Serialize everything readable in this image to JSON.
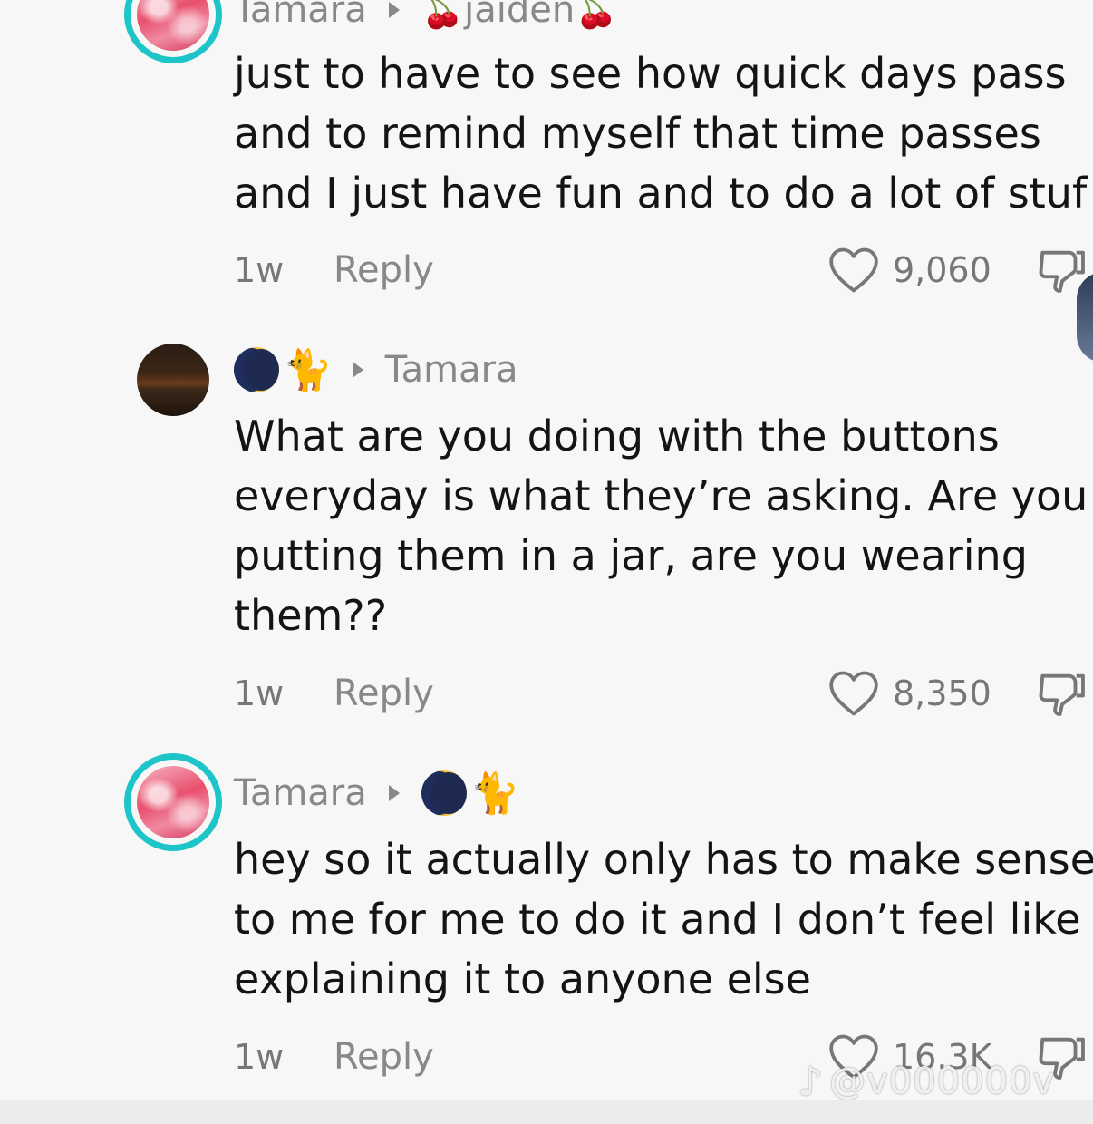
{
  "comments": [
    {
      "author": "Tamara",
      "reply_to": "jaiden",
      "reply_to_emoji": "🍒",
      "text": "just to have to see how quick days pass\nand to remind myself that time passes\nand I just have fun and to do a lot of stuf",
      "age": "1w",
      "reply_label": "Reply",
      "likes": "9,060"
    },
    {
      "author_emoji_moon": "🌗",
      "author_emoji_cat": "🐈‍⬛",
      "reply_to": "Tamara",
      "text": "What are you doing with the buttons\neveryday is what they’re asking. Are you\nputting them in a jar, are you wearing\nthem??",
      "age": "1w",
      "reply_label": "Reply",
      "likes": "8,350"
    },
    {
      "author": "Tamara",
      "reply_to_emoji_moon": "🌗",
      "reply_to_emoji_cat": "🐈‍⬛",
      "text": "hey so it actually only has to make sense\nto me for me to do it and I don’t feel like\nexplaining it to anyone else",
      "age": "1w",
      "reply_label": "Reply",
      "likes": "16.3K"
    }
  ],
  "watermark": {
    "logo": "♪",
    "handle": "@v000000v"
  },
  "colors": {
    "avatar_ring": "#1ec5c8",
    "muted_text": "#888888",
    "body_text": "#141414"
  },
  "icons": [
    "heart-outline-icon",
    "dislike-icon",
    "caret-right-icon",
    "cherry-icon",
    "moon-icon",
    "cat-icon"
  ]
}
